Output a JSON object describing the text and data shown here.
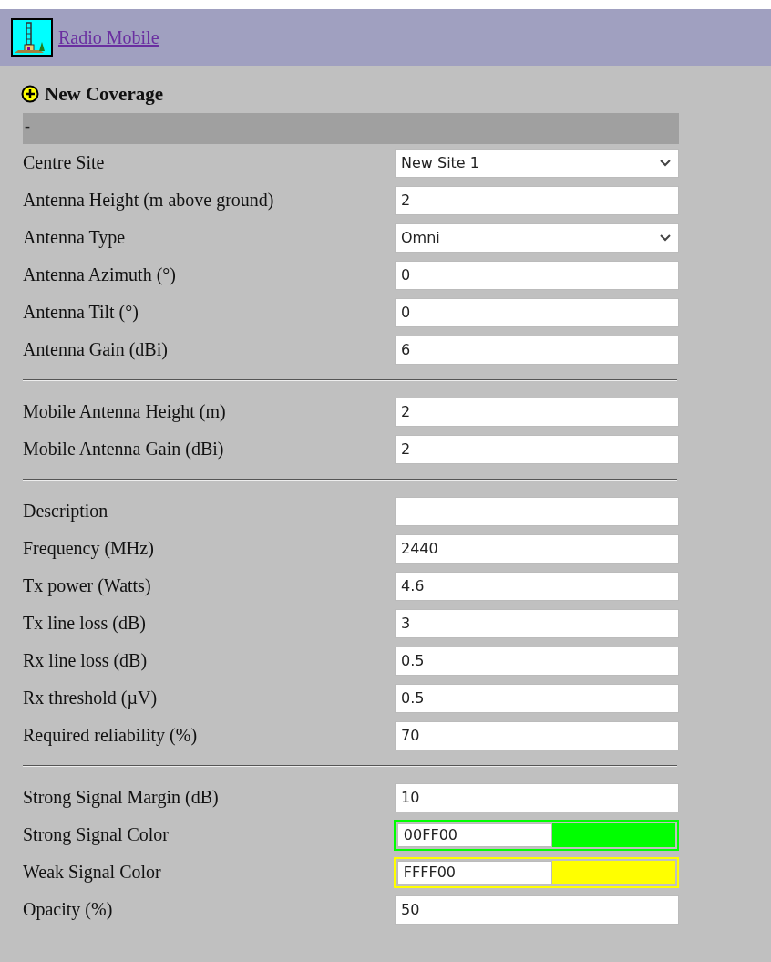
{
  "header": {
    "title": "Radio Mobile"
  },
  "form": {
    "title": "New Coverage",
    "status": "-",
    "sections": [
      [
        {
          "kind": "select",
          "label": "Centre Site",
          "value": "New Site 1"
        },
        {
          "kind": "text",
          "label": "Antenna Height (m above ground)",
          "value": "2"
        },
        {
          "kind": "select",
          "label": "Antenna Type",
          "value": "Omni"
        },
        {
          "kind": "text",
          "label": "Antenna Azimuth (°)",
          "value": "0"
        },
        {
          "kind": "text",
          "label": "Antenna Tilt (°)",
          "value": "0"
        },
        {
          "kind": "text",
          "label": "Antenna Gain (dBi)",
          "value": "6"
        }
      ],
      [
        {
          "kind": "text",
          "label": "Mobile Antenna Height (m)",
          "value": "2"
        },
        {
          "kind": "text",
          "label": "Mobile Antenna Gain (dBi)",
          "value": "2"
        }
      ],
      [
        {
          "kind": "text",
          "label": "Description"
        },
        {
          "kind": "text",
          "label": "Frequency (MHz)",
          "value": "2440"
        },
        {
          "kind": "text",
          "label": "Tx power (Watts)",
          "value": "4.6"
        },
        {
          "kind": "text",
          "label": "Tx line loss (dB)",
          "value": "3"
        },
        {
          "kind": "text",
          "label": "Rx line loss (dB)",
          "value": "0.5"
        },
        {
          "kind": "text",
          "label": "Rx threshold (µV)",
          "value": "0.5"
        },
        {
          "kind": "text",
          "label": "Required reliability (%)",
          "value": "70"
        }
      ],
      [
        {
          "kind": "text",
          "label": "Strong Signal Margin (dB)",
          "value": "10"
        },
        {
          "kind": "color",
          "label": "Strong Signal Color",
          "value": "00FF00",
          "color": "#00ff00"
        },
        {
          "kind": "color",
          "label": "Weak Signal Color",
          "value": "FFFF00",
          "color": "#ffff00"
        },
        {
          "kind": "text",
          "label": "Opacity (%)",
          "value": "50"
        }
      ]
    ]
  }
}
